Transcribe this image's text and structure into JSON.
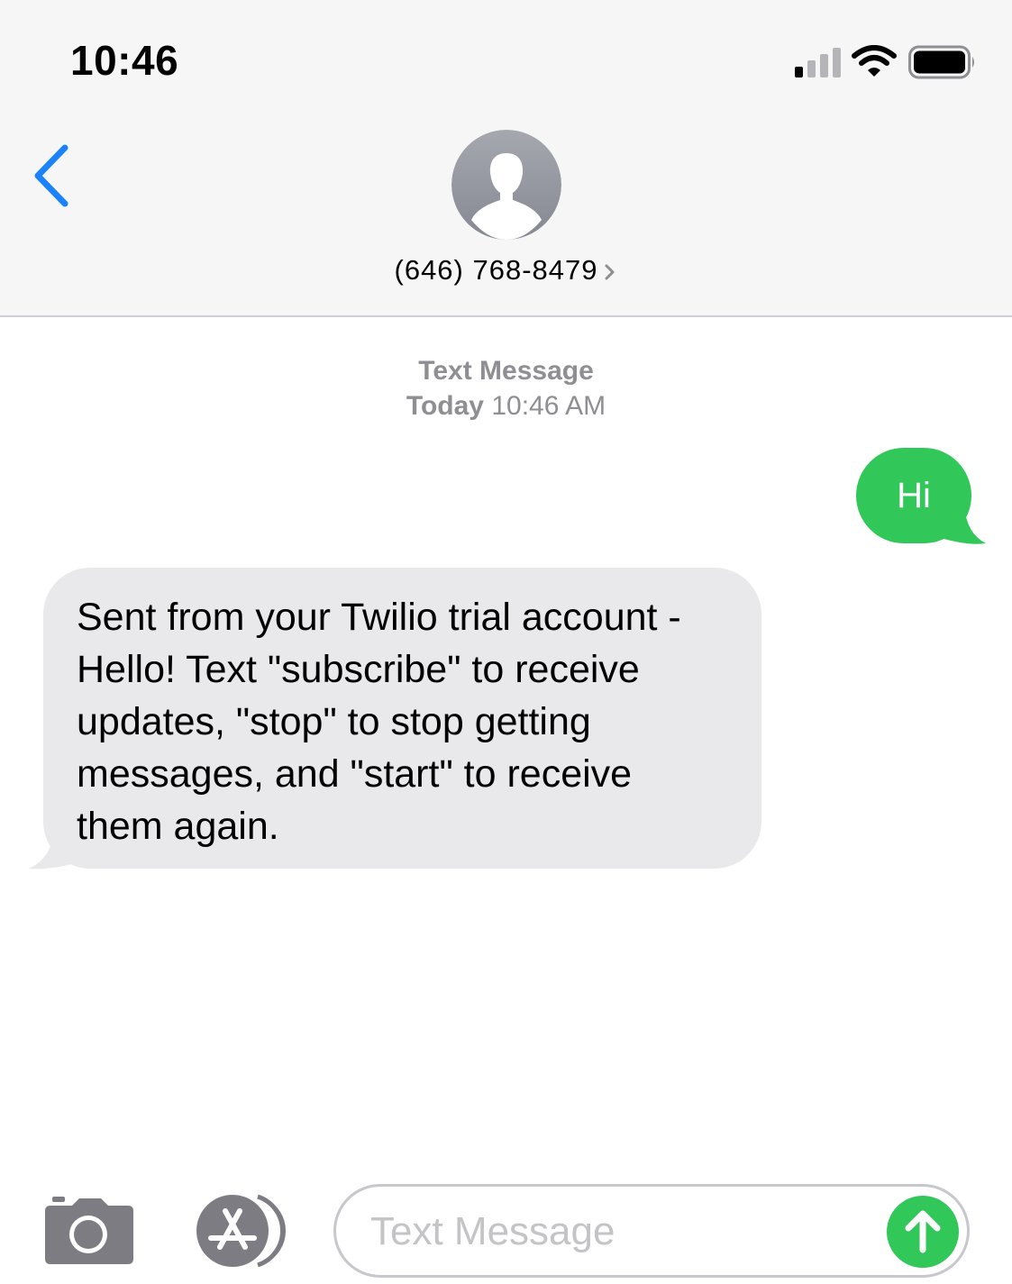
{
  "status_bar": {
    "time": "10:46"
  },
  "header": {
    "contact": "(646) 768-8479"
  },
  "conversation": {
    "service_label": "Text Message",
    "date_label": "Today",
    "time_label": "10:46 AM",
    "messages": [
      {
        "direction": "outgoing",
        "text": "Hi"
      },
      {
        "direction": "incoming",
        "text": "Sent from your Twilio trial account - Hello! Text \"subscribe\" to receive updates, \"stop\" to stop getting messages, and \"start\" to receive them again."
      }
    ]
  },
  "composer": {
    "placeholder": "Text Message"
  },
  "icons": {
    "back": "chevron-left-icon",
    "contact_chevron": "chevron-right-icon",
    "avatar": "person-silhouette-icon",
    "camera": "camera-icon",
    "apps": "app-store-icon",
    "send": "arrow-up-icon",
    "signal": "cellular-signal-icon",
    "wifi": "wifi-icon",
    "battery": "battery-icon"
  },
  "colors": {
    "ios_blue": "#1a82fb",
    "sms_green": "#32c759",
    "incoming_bubble": "#e9e9eb",
    "header_bg": "#f6f6f6",
    "meta_gray": "#8e8e93",
    "icon_gray": "#7c7c82"
  }
}
